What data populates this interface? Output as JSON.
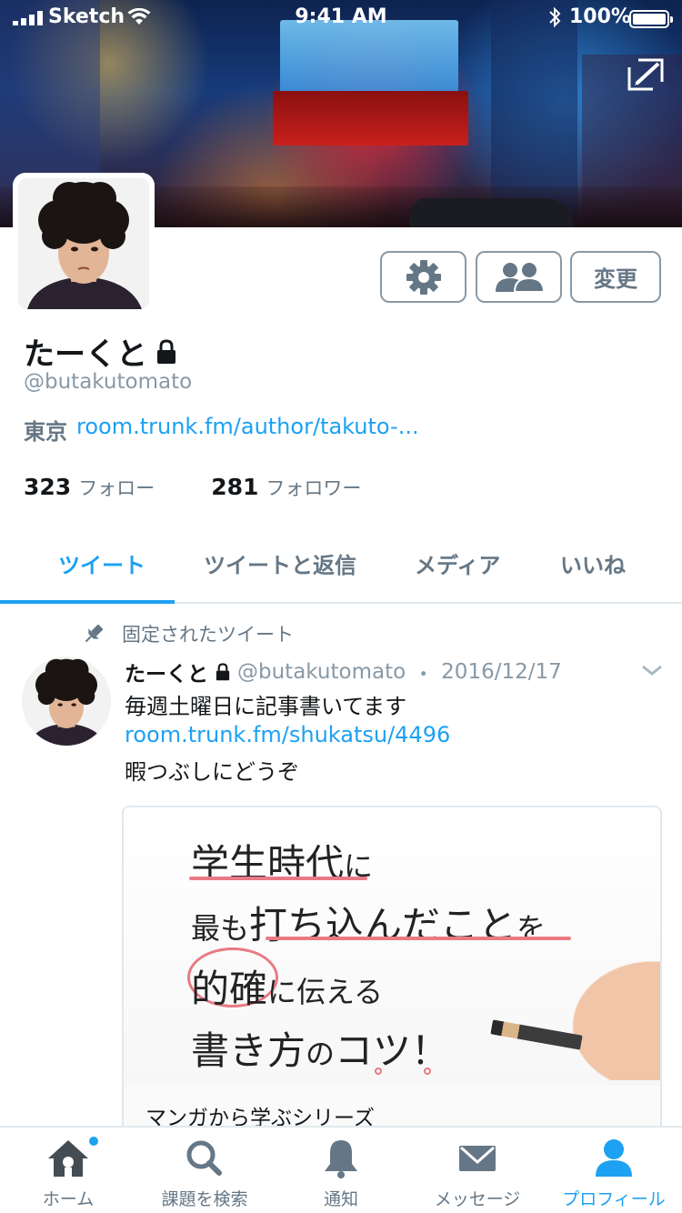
{
  "status_bar": {
    "carrier": "Sketch",
    "time": "9:41 AM",
    "battery_percent": "100%",
    "battery_level": 1.0
  },
  "header": {
    "edit_icon": "edit-header-icon"
  },
  "profile": {
    "display_name": "たーくと",
    "protected": true,
    "handle": "@butakutomato",
    "location": "東京",
    "url_text": "room.trunk.fm/author/takuto-...",
    "following_count": "323",
    "following_label": "フォロー",
    "followers_count": "281",
    "followers_label": "フォロワー",
    "buttons": {
      "settings_icon": "gear-icon",
      "people_icon": "people-icon",
      "change_label": "変更"
    }
  },
  "tabs": [
    {
      "label": "ツイート",
      "active": true
    },
    {
      "label": "ツイートと返信",
      "active": false
    },
    {
      "label": "メディア",
      "active": false
    },
    {
      "label": "いいね",
      "active": false
    }
  ],
  "pinned_tweet": {
    "pinned_label": "固定されたツイート",
    "author_name": "たーくと",
    "author_handle": "@butakutomato",
    "separator": "・",
    "date": "2016/12/17",
    "line1": "毎週土曜日に記事書いてます",
    "link": "room.trunk.fm/shukatsu/4496",
    "line3": "暇つぶしにどうぞ",
    "card": {
      "image_text": {
        "l1_main": "学生時代",
        "l1_suffix": "に",
        "l2_prefix": "最も",
        "l2_main": "打ち込んだこと",
        "l2_suffix": "を",
        "l3_main": "的確",
        "l3_suffix": "に伝える",
        "l4_main": "書き方",
        "l4_small": "の",
        "l4_suffix": "コツ！"
      },
      "title": "マンガから学ぶシリーズ"
    }
  },
  "tab_bar": [
    {
      "label": "ホーム",
      "icon": "home-icon",
      "active": false,
      "badge": true
    },
    {
      "label": "課題を検索",
      "icon": "search-icon",
      "active": false,
      "badge": false
    },
    {
      "label": "通知",
      "icon": "bell-icon",
      "active": false,
      "badge": false
    },
    {
      "label": "メッセージ",
      "icon": "envelope-icon",
      "active": false,
      "badge": false
    },
    {
      "label": "プロフィール",
      "icon": "person-icon",
      "active": true,
      "badge": false
    }
  ],
  "colors": {
    "accent": "#1da1f2",
    "secondary_text": "#657786",
    "border": "#e1e8ed",
    "highlight_pink": "#e97a84"
  }
}
